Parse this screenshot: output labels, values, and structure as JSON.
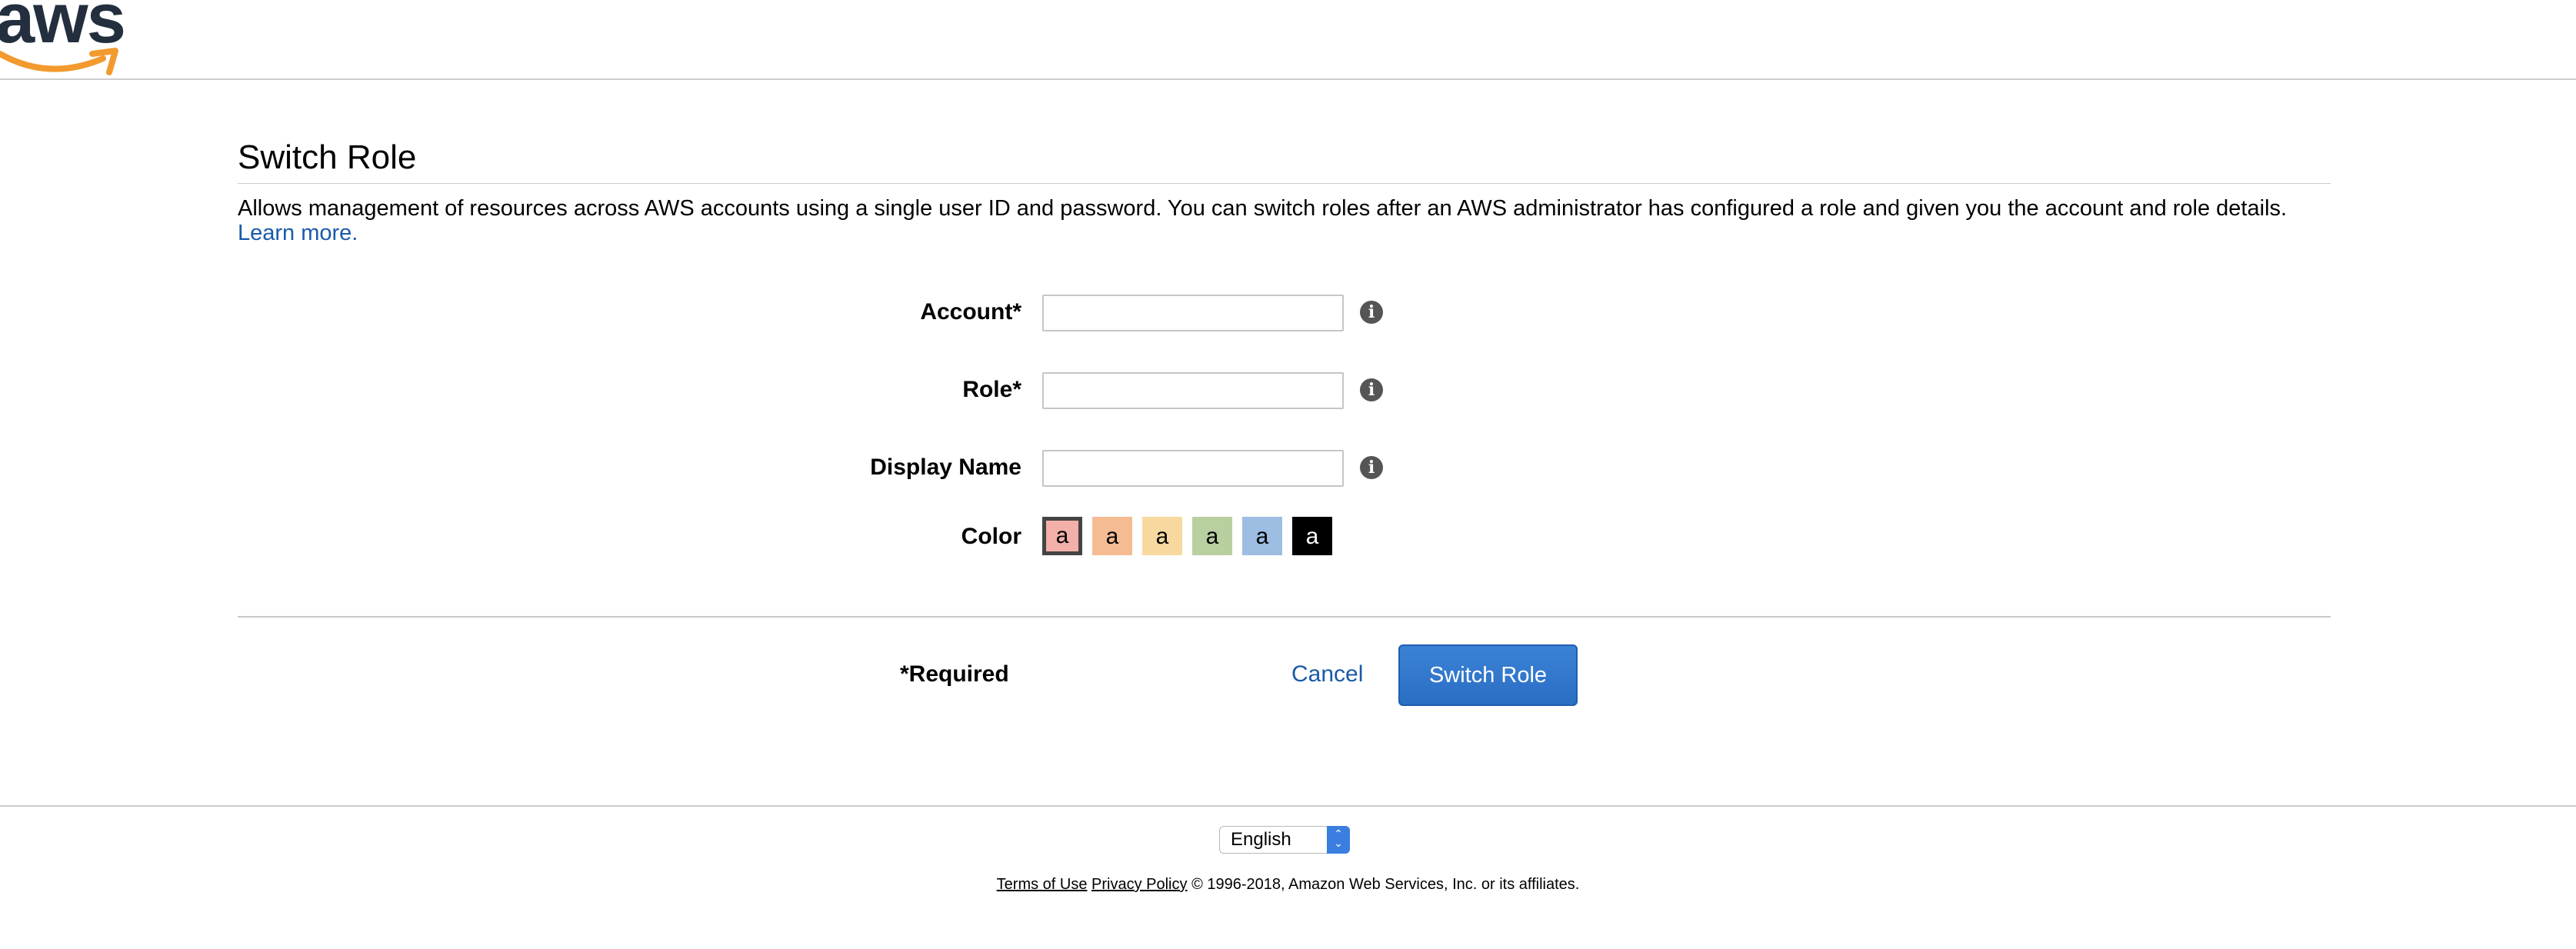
{
  "header": {
    "logo_text": "aws"
  },
  "page": {
    "title": "Switch Role",
    "description": "Allows management of resources across AWS accounts using a single user ID and password. You can switch roles after an AWS administrator has configured a role and given you the account and role details.",
    "learn_more": "Learn more."
  },
  "form": {
    "account_label": "Account*",
    "account_value": "",
    "role_label": "Role*",
    "role_value": "",
    "display_name_label": "Display Name",
    "display_name_value": "",
    "info_glyph": "i",
    "color_label": "Color",
    "swatch_glyph": "a",
    "colors": [
      "#f2b0a8",
      "#f5bb93",
      "#f7d9a0",
      "#b8d0a0",
      "#9dbde3",
      "#000000"
    ],
    "selected_color_index": 0
  },
  "actions": {
    "required_note": "*Required",
    "cancel_label": "Cancel",
    "submit_label": "Switch Role"
  },
  "footer": {
    "language": "English",
    "terms_label": "Terms of Use",
    "privacy_label": "Privacy Policy",
    "copyright": "© 1996-2018, Amazon Web Services, Inc. or its affiliates."
  }
}
